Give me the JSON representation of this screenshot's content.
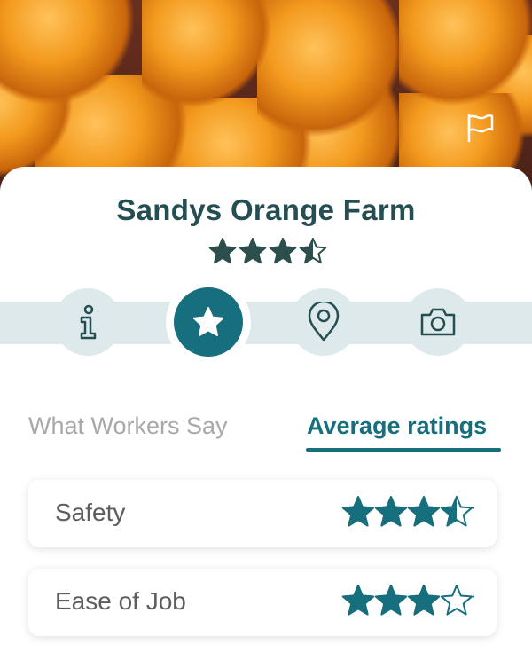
{
  "farm": {
    "name": "Sandys Orange Farm",
    "overall_rating": 3.5
  },
  "hero": {
    "image": "oranges-photo",
    "report_icon": "flag-icon"
  },
  "nav": {
    "items": [
      {
        "name": "info",
        "icon": "info-icon",
        "active": false
      },
      {
        "name": "ratings",
        "icon": "star-icon",
        "active": true
      },
      {
        "name": "location",
        "icon": "location-pin-icon",
        "active": false
      },
      {
        "name": "photos",
        "icon": "camera-icon",
        "active": false
      }
    ]
  },
  "tabs": {
    "workers_label": "What Workers Say",
    "ratings_label": "Average ratings",
    "active": "ratings"
  },
  "ratings": [
    {
      "label": "Safety",
      "value": 3.5
    },
    {
      "label": "Ease of Job",
      "value": 3
    }
  ],
  "colors": {
    "accent": "#176e7c",
    "title": "#244e52",
    "nav_track": "#dde9ea",
    "inactive_tab": "#a8a8a8"
  }
}
